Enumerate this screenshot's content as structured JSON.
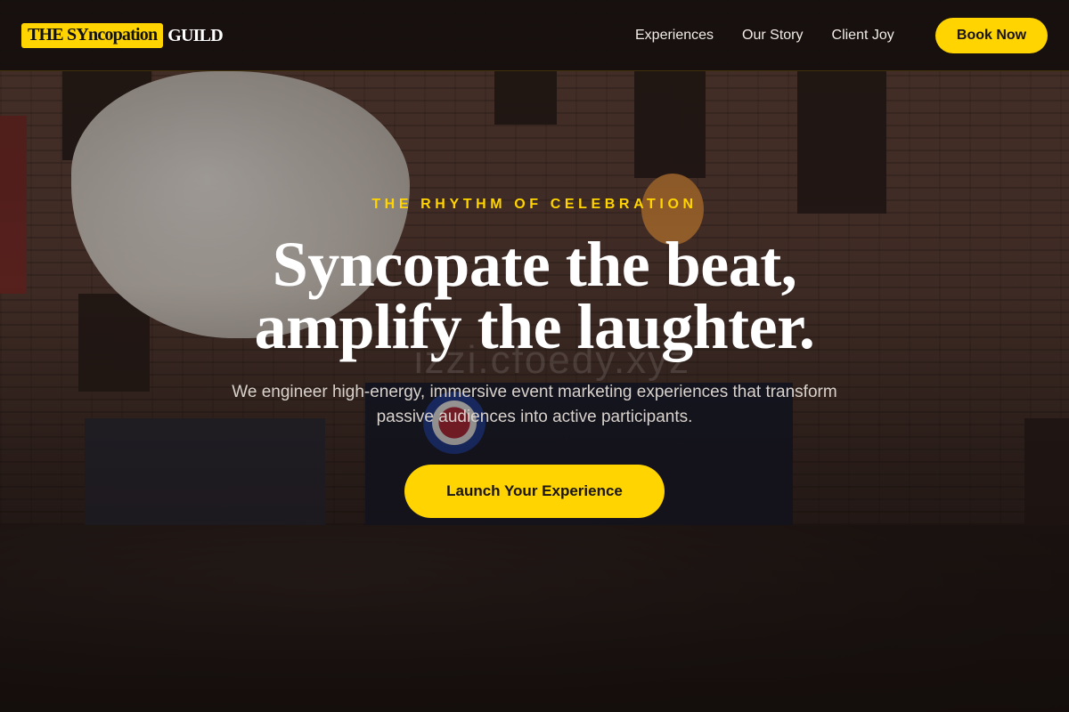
{
  "brand": {
    "logo_highlight": "THE SYncopation",
    "logo_rest": "GUILD"
  },
  "nav": {
    "links": [
      "Experiences",
      "Our Story",
      "Client Joy"
    ],
    "book_label": "Book Now"
  },
  "hero": {
    "eyebrow": "THE RHYTHM OF CELEBRATION",
    "headline_line1": "Syncopate the beat,",
    "headline_line2": "amplify the laughter.",
    "subtext": "We engineer high-energy, immersive event marketing experiences that transform passive audiences into active participants.",
    "cta_label": "Launch Your Experience",
    "background_image": "event-crowd-photo",
    "watermark": "izzi.cfoedy.xyz"
  },
  "colors": {
    "accent": "#ffd400",
    "nav_background": "#140e0d",
    "text_light": "#ffffff"
  }
}
